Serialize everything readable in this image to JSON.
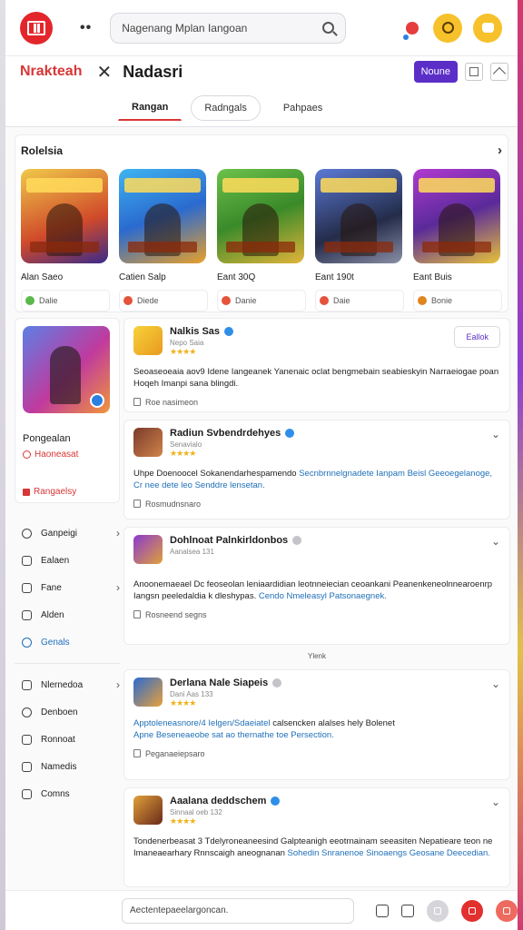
{
  "header": {
    "search_text": "Nagenang Mplan Iangoan",
    "menu_dots": "••"
  },
  "titlebar": {
    "brand": "Nrakteah",
    "close_glyph": "✕",
    "title": "Nadasri",
    "primary_button": "Noune"
  },
  "tabs": [
    {
      "label": "Rangan"
    },
    {
      "label": "Radngals"
    },
    {
      "label": "Pahpaes"
    }
  ],
  "featured": {
    "heading": "Rolelsia",
    "games": [
      {
        "name": "Alan Saeo",
        "meta": "Dalie"
      },
      {
        "name": "Catien Salp",
        "meta": "Diede"
      },
      {
        "name": "Eant 30Q",
        "meta": "Danie"
      },
      {
        "name": "Eant 190t",
        "meta": "Daie"
      },
      {
        "name": "Eant Buis",
        "meta": "Bonie"
      }
    ]
  },
  "profile": {
    "name": "Pongealan",
    "link1": "Haoneasat",
    "link2": "Rangaelsy"
  },
  "nav": {
    "group1": [
      {
        "label": "Ganpeigi"
      },
      {
        "label": "Ealaen"
      },
      {
        "label": "Fane"
      },
      {
        "label": "Alden"
      },
      {
        "label": "Genals"
      }
    ],
    "group2": [
      {
        "label": "Nlernedoa"
      },
      {
        "label": "Denboen"
      },
      {
        "label": "Ronnoat"
      },
      {
        "label": "Namedis"
      },
      {
        "label": "Comns"
      }
    ]
  },
  "posts": [
    {
      "title": "Nalkis Sas",
      "sub": "Nepo Saia",
      "button": "Eallok",
      "body": "Seoaseoeaia aov9 Idene Iangeanek Yanenaic oclat bengmebain seabieskyin Narraeiogae poan Hoqeh Imanpi sana blingdi.",
      "link": "",
      "foot": "Roe nasimeon"
    },
    {
      "title": "Radiun Svbendrdehyes",
      "sub": "Senavialo",
      "body": "Uhpe Doenoocel Sokanendarhespamendo ",
      "link": "Secnbrnnelgnadete Ianpam Beisl Geeoegelanoge, Cr nee dete leo Senddre lensetan.",
      "foot": "Rosmudnsnaro"
    },
    {
      "title": "Dohlnoat Palnkirldonbos",
      "sub": "Aanalsea 131",
      "body": "Anoonemaeael Dc feoseolan leniaardidian leotnneiecian ceoankani Peanenkeneolnnearoenrp Iangsn peeledaldia k dleshypas.",
      "link": "Cendo Nmeleasyl Patsonaegnek.",
      "foot": "Rosneend segns"
    },
    {
      "title": "Derlana Nale Siapeis",
      "sub": "Dani Aas 133",
      "body": "",
      "link": "Apptoleneasnore/4 Ielgen/Sdaeiatel ",
      "body2": "calsencken alalses hely Bolenet",
      "link2": "Apne Beseneaeobe sat ao thernathe toe Persection.",
      "foot": "Peganaeiepsaro"
    },
    {
      "title": "Aaalana deddschem",
      "sub": "Sinnaal oeb 132",
      "body": "Tondenerbeasat 3 Tdelyroneaneesind Galpteanigh eeotrnainam seeasiten Nepatieare teon ne Imaneaearhary Rnnscaigh aneognanan",
      "link": "Sohedin Snranenoe Sinoaengs Geosane Deecedian.",
      "foot": ""
    }
  ],
  "mid_label": "Ylenk",
  "composer": {
    "placeholder": "Aectentepaeelargoncan."
  }
}
